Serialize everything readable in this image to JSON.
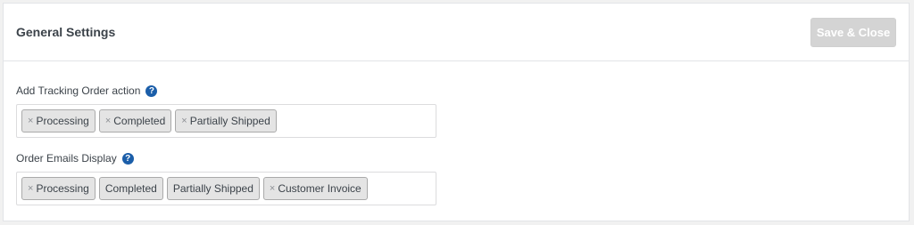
{
  "header": {
    "title": "General Settings",
    "save_label": "Save & Close"
  },
  "fields": [
    {
      "label": "Add Tracking Order action",
      "help": "?",
      "tags": [
        {
          "label": "Processing",
          "removable": true
        },
        {
          "label": "Completed",
          "removable": true
        },
        {
          "label": "Partially Shipped",
          "removable": true
        }
      ]
    },
    {
      "label": "Order Emails Display",
      "help": "?",
      "tags": [
        {
          "label": "Processing",
          "removable": true
        },
        {
          "label": "Completed",
          "removable": false
        },
        {
          "label": "Partially Shipped",
          "removable": false
        },
        {
          "label": "Customer Invoice",
          "removable": true
        }
      ]
    }
  ],
  "icons": {
    "remove": "×"
  },
  "colors": {
    "help_icon": "#1b5ea9",
    "save_button_disabled": "#d4d4d4"
  }
}
